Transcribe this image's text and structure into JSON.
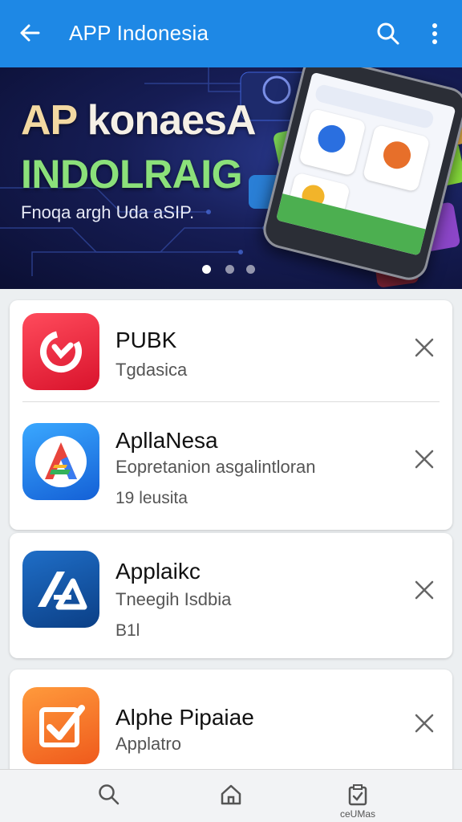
{
  "appbar": {
    "title": "APP Indonesia",
    "back_icon": "arrow-back-icon",
    "search_icon": "search-icon",
    "more_icon": "more-vert-icon",
    "color": "#1e88e5"
  },
  "banner": {
    "headline_first": "AP",
    "headline_rest": " konaesA",
    "headline_2": "INDOLRAIG",
    "subtitle": "Fnoqa argh Uda aSIP.",
    "dots": 3,
    "active_dot": 1
  },
  "apps": [
    {
      "name": "PUBK",
      "desc": "Tgdasica",
      "meta": "",
      "icon": "red-g-app-icon"
    },
    {
      "name": "ApllaNesa",
      "desc": "Eopretanion asgalintloran",
      "meta": "19 leusita",
      "icon": "colorful-a-app-icon"
    },
    {
      "name": "Applaikc",
      "desc": "Tneegih Isdbia",
      "meta": "B1l",
      "icon": "blue-a-app-icon"
    },
    {
      "name": "Alphe Pipaiae",
      "desc": "Applatro",
      "meta": "",
      "icon": "orange-check-app-icon"
    }
  ],
  "bottomnav": {
    "items": [
      {
        "icon": "search-icon",
        "label": ""
      },
      {
        "icon": "home-icon",
        "label": ""
      },
      {
        "icon": "clipboard-check-icon",
        "label": "ceUMas"
      }
    ]
  }
}
